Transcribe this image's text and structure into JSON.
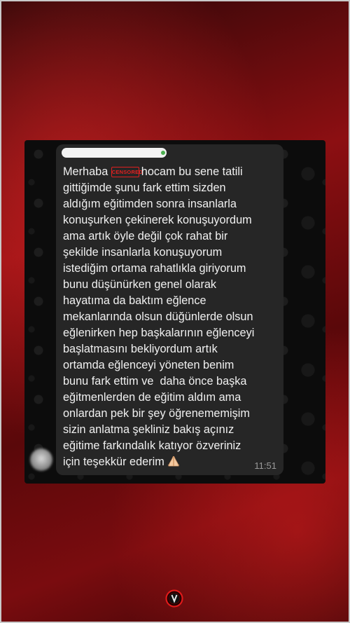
{
  "chat": {
    "greeting": "Merhaba ",
    "censor_badge": "CENSORED",
    "line1_rest": "hocam bu sene tatili",
    "lines": [
      "gittiğimde şunu fark ettim sizden",
      "aldığım eğitimden sonra insanlarla",
      "konuşurken çekinerek konuşuyordum",
      "ama artık öyle değil çok rahat bir",
      "şekilde insanlarla konuşuyorum",
      "istediğim ortama rahatlıkla giriyorum",
      "bunu düşünürken genel olarak",
      "hayatıma da baktım eğlence",
      "mekanlarında olsun düğünlerde olsun",
      "eğlenirken hep başkalarının eğlenceyi",
      "başlatmasını bekliyordum artık",
      "ortamda eğlenceyi yöneten benim",
      "bunu fark ettim ve  daha önce başka",
      "eğitmenlerden de eğitim aldım ama",
      "onlardan pek bir şey öğrenememişim",
      "sizin anlatma şekliniz bakış açınız",
      "eğitime farkındalık katıyor özveriniz"
    ],
    "last_line": "için teşekkür ederim ",
    "emoji": "folded-hands-emoji",
    "time": "11:51"
  },
  "colors": {
    "bubble": "#262626",
    "text": "#f0f0f0",
    "censor": "#e02020",
    "background_red": "#8c0f12"
  }
}
